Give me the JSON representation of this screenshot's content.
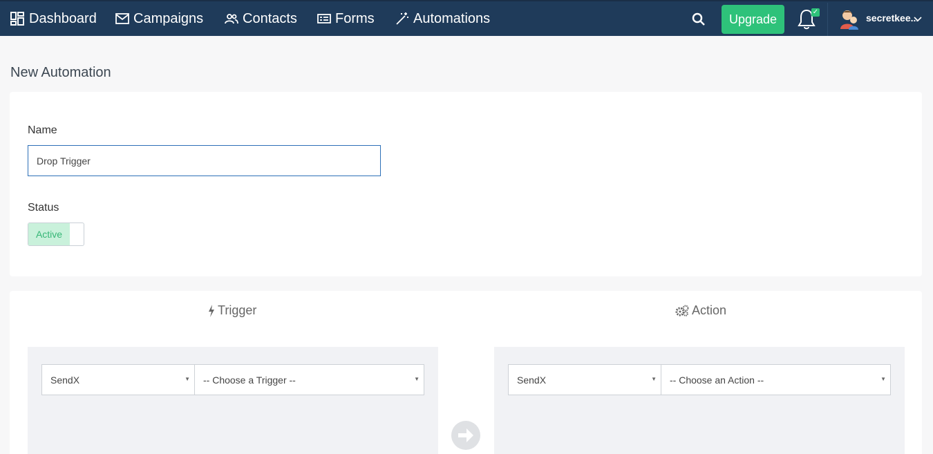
{
  "nav": {
    "dashboard": "Dashboard",
    "campaigns": "Campaigns",
    "contacts": "Contacts",
    "forms": "Forms",
    "automations": "Automations",
    "upgrade": "Upgrade",
    "user_name": "secretkee..."
  },
  "page": {
    "title": "New Automation"
  },
  "form": {
    "name_label": "Name",
    "name_value": "Drop Trigger",
    "status_label": "Status",
    "status_value": "Active"
  },
  "trigger": {
    "heading": "Trigger",
    "app": "SendX",
    "choice": "-- Choose a Trigger --"
  },
  "action": {
    "heading": "Action",
    "app": "SendX",
    "choice": "-- Choose an Action --"
  },
  "colors": {
    "nav_bg": "#1f3b5a",
    "upgrade_bg": "#2ec27a",
    "active_bg": "#c9f1db",
    "active_text": "#35b676",
    "input_border_focus": "#2c6fb7"
  }
}
